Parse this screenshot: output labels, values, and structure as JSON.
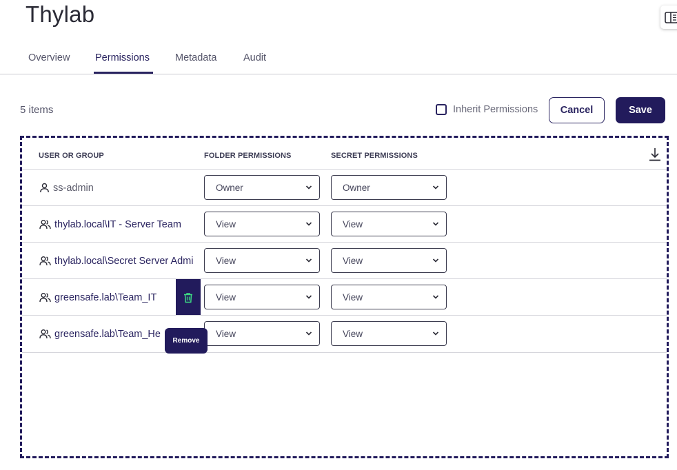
{
  "page": {
    "title": "Thylab"
  },
  "tabs": [
    {
      "label": "Overview",
      "active": false
    },
    {
      "label": "Permissions",
      "active": true
    },
    {
      "label": "Metadata",
      "active": false
    },
    {
      "label": "Audit",
      "active": false
    }
  ],
  "toolbar": {
    "item_count": "5 items",
    "inherit_label": "Inherit Permissions",
    "inherit_checked": false,
    "cancel_label": "Cancel",
    "save_label": "Save"
  },
  "table": {
    "headers": {
      "user_or_group": "USER OR GROUP",
      "folder_permissions": "FOLDER PERMISSIONS",
      "secret_permissions": "SECRET PERMISSIONS"
    },
    "rows": [
      {
        "name": "ss-admin",
        "type": "user-icon",
        "folder": "Owner",
        "secret": "Owner"
      },
      {
        "name": "thylab.local\\IT - Server Team",
        "type": "group-icon",
        "folder": "View",
        "secret": "View"
      },
      {
        "name": "thylab.local\\Secret Server Admi",
        "type": "group-icon",
        "folder": "View",
        "secret": "View"
      },
      {
        "name": "greensafe.lab\\Team_IT",
        "type": "group-icon",
        "folder": "View",
        "secret": "View"
      },
      {
        "name": "greensafe.lab\\Team_He",
        "type": "group-icon",
        "folder": "View",
        "secret": "View"
      }
    ]
  },
  "tooltip": {
    "label": "Remove"
  },
  "colors": {
    "primary": "#221b5c",
    "trash": "#3ddc84",
    "border": "#d6d6dc"
  }
}
